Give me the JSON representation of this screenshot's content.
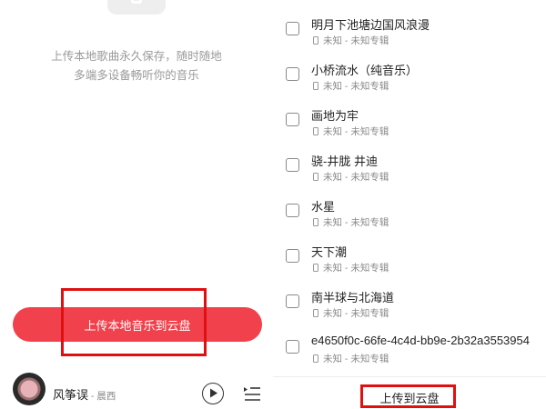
{
  "left_panel": {
    "promo_line1": "上传本地歌曲永久保存，随时随地",
    "promo_line2": "多端多设备畅听你的音乐",
    "upload_local_button": "上传本地音乐到云盘",
    "player": {
      "song_title": "风筝误",
      "separator": " - ",
      "artist": "晨西"
    }
  },
  "right_panel": {
    "songs": [
      {
        "title": "明月下池塘边国风浪漫",
        "meta": "未知 - 未知专辑"
      },
      {
        "title": "小桥流水（纯音乐）",
        "meta": "未知 - 未知专辑"
      },
      {
        "title": "画地为牢",
        "meta": "未知 - 未知专辑"
      },
      {
        "title": "骁-井胧 井迪",
        "meta": "未知 - 未知专辑"
      },
      {
        "title": "水星",
        "meta": "未知 - 未知专辑"
      },
      {
        "title": "天下潮",
        "meta": "未知 - 未知专辑"
      },
      {
        "title": "南半球与北海道",
        "meta": "未知 - 未知专辑"
      },
      {
        "title": "e4650f0c-66fe-4c4d-bb9e-2b32a3553954",
        "meta": "未知 - 未知专辑"
      }
    ],
    "upload_cloud_button": "上传到云盘"
  },
  "colors": {
    "accent": "#f1414c",
    "highlight_box": "#e01010",
    "muted_text": "#9a9a9a"
  },
  "icons": {
    "play": "play-icon",
    "playlist": "playlist-icon",
    "local_file": "phone-icon"
  }
}
